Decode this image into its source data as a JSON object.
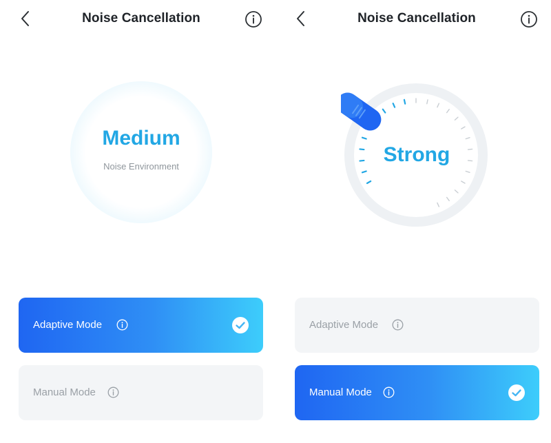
{
  "screens": [
    {
      "title": "Noise Cancellation",
      "display_value": "Medium",
      "display_sub": "Noise Environment",
      "modes": [
        {
          "label": "Adaptive Mode",
          "selected": true
        },
        {
          "label": "Manual Mode",
          "selected": false
        }
      ]
    },
    {
      "title": "Noise Cancellation",
      "display_value": "Strong",
      "modes": [
        {
          "label": "Adaptive Mode",
          "selected": false
        },
        {
          "label": "Manual Mode",
          "selected": true
        }
      ]
    }
  ],
  "colors": {
    "accent": "#22a7e4",
    "active_gradient_start": "#1f66f2",
    "active_gradient_end": "#3dcdfb",
    "inactive_card": "#f3f5f7",
    "title_text": "#1f2328",
    "muted_text": "#9aa0a6"
  },
  "icons": [
    "chevron-left-icon",
    "info-icon",
    "check-circle-icon"
  ]
}
